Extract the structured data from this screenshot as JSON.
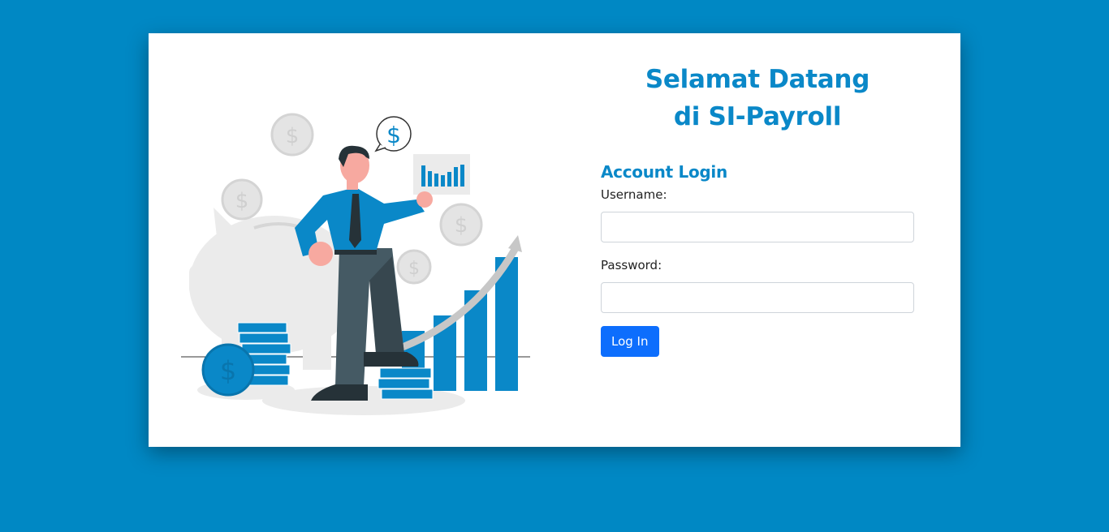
{
  "header": {
    "title_line1": "Selamat Datang",
    "title_line2": "di SI-Payroll"
  },
  "login": {
    "heading": "Account Login",
    "username_label": "Username:",
    "username_value": "",
    "password_label": "Password:",
    "password_value": "",
    "submit_label": "Log In"
  },
  "illustration": {
    "currency_symbol": "$",
    "icon": "finance-growth-illustration"
  },
  "colors": {
    "background": "#0088c4",
    "accent": "#0a88c8",
    "button": "#0d6efd"
  }
}
